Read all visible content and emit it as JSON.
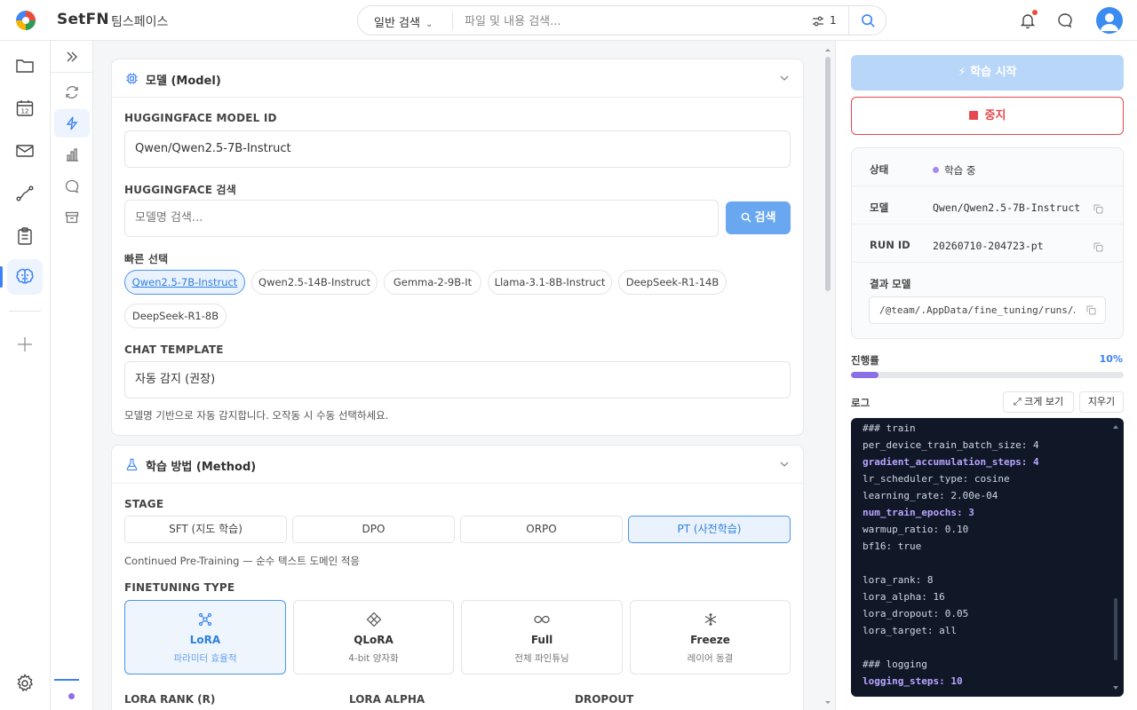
{
  "topbar": {
    "brand": "SetFN",
    "workspace": "팀스페이스",
    "search_mode": "일반 검색",
    "search_placeholder": "파일 및 내용 검색...",
    "filter_count": "1"
  },
  "model_card": {
    "title": "모델 (Model)",
    "hf_model_id_label": "HUGGINGFACE MODEL ID",
    "hf_model_id_value": "Qwen/Qwen2.5-7B-Instruct",
    "hf_search_label": "HUGGINGFACE 검색",
    "hf_search_placeholder": "모델명 검색...",
    "hf_search_button": "검색",
    "quick_select_label": "빠른 선택",
    "quick_chips": [
      "Qwen2.5-7B-Instruct",
      "Qwen2.5-14B-Instruct",
      "Gemma-2-9B-It",
      "Llama-3.1-8B-Instruct",
      "DeepSeek-R1-14B",
      "DeepSeek-R1-8B"
    ],
    "chat_template_label": "CHAT TEMPLATE",
    "chat_template_value": "자동 감지 (권장)",
    "chat_template_hint": "모델명 기반으로 자동 감지합니다. 오작동 시 수동 선택하세요."
  },
  "method_card": {
    "title": "학습 방법 (Method)",
    "stage_label": "STAGE",
    "stages": [
      "SFT (지도 학습)",
      "DPO",
      "ORPO",
      "PT (사전학습)"
    ],
    "stage_hint": "Continued Pre-Training — 순수 텍스트 도메인 적응",
    "finetuning_label": "FINETUNING TYPE",
    "finetuning_types": [
      {
        "title": "LoRA",
        "subtitle": "파라미터 효율적"
      },
      {
        "title": "QLoRA",
        "subtitle": "4-bit 양자화"
      },
      {
        "title": "Full",
        "subtitle": "전체 파인튜닝"
      },
      {
        "title": "Freeze",
        "subtitle": "레이어 동결"
      }
    ],
    "lora_rank_label": "LORA RANK (R)",
    "lora_alpha_label": "LORA ALPHA",
    "dropout_label": "DROPOUT"
  },
  "right_panel": {
    "start_button": "학습 시작",
    "stop_button": "중지",
    "status_key": "상태",
    "status_value": "학습 중",
    "model_key": "모델",
    "model_value": "Qwen/Qwen2.5-7B-Instruct",
    "run_id_key": "RUN ID",
    "run_id_value": "20260710-204723-pt",
    "result_model_key": "결과 모델",
    "result_model_value": "/@team/.AppData/fine_tuning/runs/…",
    "progress_label": "진행률",
    "progress_text": "10%",
    "progress_value": 0.1,
    "log_label": "로그",
    "expand_button": "크게 보기",
    "clear_button": "지우기",
    "log_lines": [
      {
        "text": "### train",
        "hl": false
      },
      {
        "text": "per_device_train_batch_size: 4",
        "hl": false
      },
      {
        "text": "gradient_accumulation_steps: 4",
        "hl": true
      },
      {
        "text": "lr_scheduler_type: cosine",
        "hl": false
      },
      {
        "text": "learning_rate: 2.00e-04",
        "hl": false
      },
      {
        "text": "num_train_epochs: 3",
        "hl": true
      },
      {
        "text": "warmup_ratio: 0.10",
        "hl": false
      },
      {
        "text": "bf16: true",
        "hl": false
      },
      {
        "text": "",
        "hl": false
      },
      {
        "text": "lora_rank: 8",
        "hl": false
      },
      {
        "text": "lora_alpha: 16",
        "hl": false
      },
      {
        "text": "lora_dropout: 0.05",
        "hl": false
      },
      {
        "text": "lora_target: all",
        "hl": false
      },
      {
        "text": "",
        "hl": false
      },
      {
        "text": "### logging",
        "hl": false
      },
      {
        "text": "logging_steps: 10",
        "hl": true
      }
    ]
  },
  "colors": {
    "accent": "#3b82f6",
    "progress": "#8b6fe8",
    "danger": "#e5484d",
    "log_bg": "#101828"
  }
}
